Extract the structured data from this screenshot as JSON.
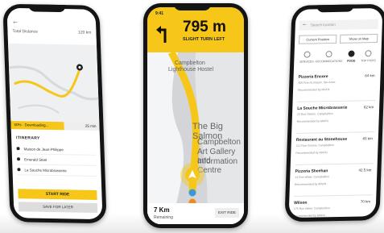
{
  "left_phone": {
    "back_icon": "back-arrow-icon",
    "summary_label": "Total Distance",
    "summary_value": "120 km",
    "progress": {
      "label": "50% · Downloading...",
      "time": "25 min",
      "fraction": 0.6
    },
    "itinerary_title": "ITINERARY",
    "stops": [
      "Maison de Jean-Philippe",
      "Emerald Steel",
      "La Souche Microbrasserie"
    ],
    "start_label": "START RIDE",
    "save_label": "SAVE FOR LATER"
  },
  "middle_phone": {
    "status_time": "9:41",
    "turn_icon": "turn-left-arrow-icon",
    "distance": "795 m",
    "instruction": "SLIGHT TURN LEFT",
    "map_labels": [
      "Campbelton",
      "Lighthouse Hostel",
      "The Big Salmon",
      "Campbelton",
      "Art Gallery and",
      "Information Centre"
    ],
    "remaining_value": "7 Km",
    "remaining_label": "Remaining",
    "exit_label": "EXIT RIDE"
  },
  "right_phone": {
    "search_placeholder": "Search location",
    "buttons": [
      "Current Position",
      "Show on Map"
    ],
    "categories": [
      "SERVICES",
      "ACCOMMODATIONS",
      "FOOD",
      "TOP PICKS"
    ],
    "active_category": 2,
    "results": [
      {
        "name": "Pizzeria Encore",
        "address": "456 Rue du Bassin, Ste-Anne",
        "recommended": "Recommended by MAFN",
        "distance": "64 km"
      },
      {
        "name": "La Souche Microbrasserie",
        "address": "23 Rue Nelson, Campbellton",
        "recommended": "Recommended by MAFN",
        "distance": "62 km"
      },
      {
        "name": "Restaurant au Stonehouse",
        "address": "212 Rue Victoria, Campbellton",
        "recommended": "Recommended by MAFN",
        "distance": "65 km"
      },
      {
        "name": "Pizzeria Sheehan",
        "address": "14 Rue Water, Campbellton",
        "recommended": "Recommended by MAFN",
        "distance": "42.5 km"
      },
      {
        "name": "Wilson",
        "address": "175 Rue Water, Campbellton",
        "recommended": "Recommended by MAFN",
        "distance": "70 km"
      }
    ]
  }
}
